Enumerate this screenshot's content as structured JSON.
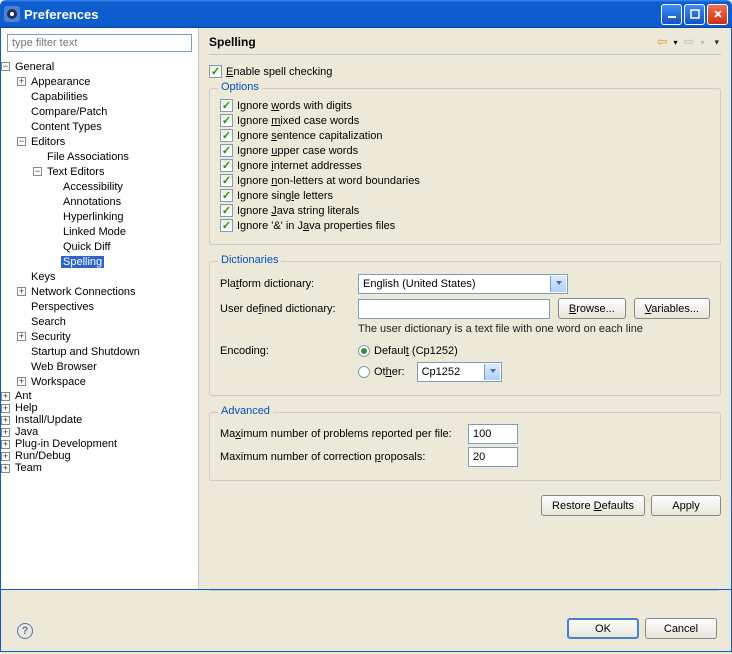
{
  "window": {
    "title": "Preferences"
  },
  "filter": {
    "placeholder": "type filter text"
  },
  "tree": {
    "general": "General",
    "appearance": "Appearance",
    "capabilities": "Capabilities",
    "compare_patch": "Compare/Patch",
    "content_types": "Content Types",
    "editors": "Editors",
    "file_assoc": "File Associations",
    "text_editors": "Text Editors",
    "accessibility": "Accessibility",
    "annotations": "Annotations",
    "hyperlinking": "Hyperlinking",
    "linked_mode": "Linked Mode",
    "quick_diff": "Quick Diff",
    "spelling": "Spelling",
    "keys": "Keys",
    "network": "Network Connections",
    "perspectives": "Perspectives",
    "search": "Search",
    "security": "Security",
    "startup": "Startup and Shutdown",
    "web_browser": "Web Browser",
    "workspace": "Workspace",
    "ant": "Ant",
    "help": "Help",
    "install_update": "Install/Update",
    "java": "Java",
    "plugin_dev": "Plug-in Development",
    "run_debug": "Run/Debug",
    "team": "Team"
  },
  "page": {
    "title": "Spelling",
    "enable": {
      "label": "Enable spell checking",
      "e_pre": "",
      "e_u": "E",
      "e_post": "nable spell checking"
    },
    "options": {
      "title": "Options",
      "digits": {
        "pre": "Ignore ",
        "u": "w",
        "post": "ords with digits"
      },
      "mixed": {
        "pre": "Ignore ",
        "u": "m",
        "post": "ixed case words"
      },
      "sentence": {
        "pre": "Ignore ",
        "u": "s",
        "post": "entence capitalization"
      },
      "upper": {
        "pre": "Ignore ",
        "u": "u",
        "post": "pper case words"
      },
      "internet": {
        "pre": "Ignore ",
        "u": "i",
        "post": "nternet addresses"
      },
      "nonletters": {
        "pre": "Ignore ",
        "u": "n",
        "post": "on-letters at word boundaries"
      },
      "single": {
        "pre": "Ignore sing",
        "u": "l",
        "post": "e letters"
      },
      "javastr": {
        "pre": "Ignore ",
        "u": "J",
        "post": "ava string literals"
      },
      "amp": {
        "pre": "Ignore '&' in J",
        "u": "a",
        "post": "va properties files"
      }
    },
    "dict": {
      "title": "Dictionaries",
      "platform_label": "Platform dictionary:",
      "platform_label_pre": "Pla",
      "platform_label_u": "t",
      "platform_label_post": "form dictionary:",
      "platform_value": "English (United States)",
      "user_label": "User defined dictionary:",
      "user_label_pre": "User de",
      "user_label_u": "f",
      "user_label_post": "ined dictionary:",
      "browse": "Browse...",
      "variables": "Variables...",
      "hint": "The user dictionary is a text file with one word on each line",
      "encoding_label": "Encoding:",
      "default_enc_pre": "Defaul",
      "default_enc_u": "t",
      "default_enc_post": " (Cp1252)",
      "other_label_pre": "Ot",
      "other_label_u": "h",
      "other_label_post": "er:",
      "other_value": "Cp1252"
    },
    "advanced": {
      "title": "Advanced",
      "max_problems_label": "Maximum number of problems reported per file:",
      "max_problems_value": "100",
      "max_proposals_label": "Maximum number of correction proposals:",
      "max_proposals_value": "20"
    },
    "restore_defaults": "Restore Defaults",
    "apply": "Apply"
  },
  "buttons": {
    "ok": "OK",
    "cancel": "Cancel"
  }
}
